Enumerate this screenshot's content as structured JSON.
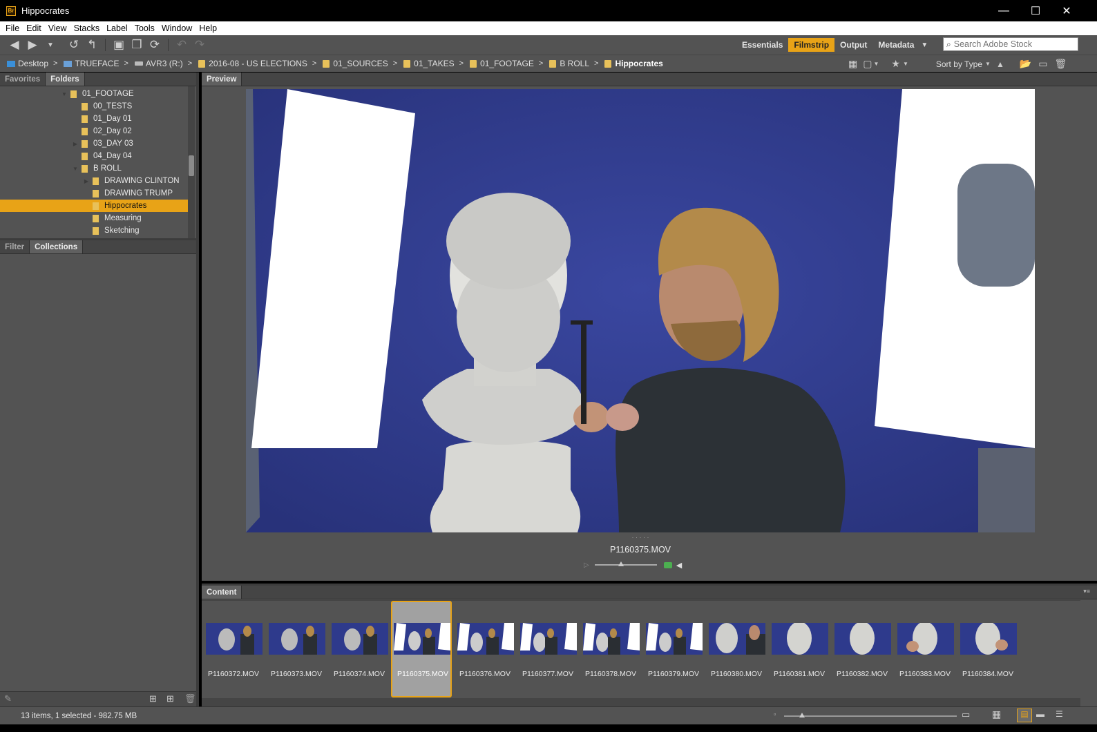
{
  "window": {
    "title": "Hippocrates",
    "app_icon_text": "Br",
    "minimize": "—",
    "maximize": "☐",
    "close": "✕"
  },
  "menu": [
    "File",
    "Edit",
    "View",
    "Stacks",
    "Label",
    "Tools",
    "Window",
    "Help"
  ],
  "workspaces": {
    "items": [
      "Essentials",
      "Filmstrip",
      "Output",
      "Metadata"
    ],
    "active": "Filmstrip"
  },
  "search": {
    "placeholder": "Search Adobe Stock"
  },
  "path": [
    "Desktop",
    "TRUEFACE",
    "AVR3 (R:)",
    "2016-08 - US ELECTIONS",
    "01_SOURCES",
    "01_TAKES",
    "01_FOOTAGE",
    "B ROLL",
    "Hippocrates"
  ],
  "sort": {
    "label": "Sort by Type"
  },
  "left_tabs_top": [
    "Favorites",
    "Folders"
  ],
  "left_tabs_bottom": [
    "Filter",
    "Collections"
  ],
  "folders": [
    {
      "label": "01_FOOTAGE",
      "level": 0,
      "expanded": true
    },
    {
      "label": "00_TESTS",
      "level": 1
    },
    {
      "label": "01_Day 01",
      "level": 1
    },
    {
      "label": "02_Day 02",
      "level": 1
    },
    {
      "label": "03_DAY 03",
      "level": 1,
      "collapsed": true
    },
    {
      "label": "04_Day 04",
      "level": 1
    },
    {
      "label": "B ROLL",
      "level": 1,
      "expanded": true
    },
    {
      "label": "DRAWING CLINTON",
      "level": 2,
      "collapsed": true
    },
    {
      "label": "DRAWING TRUMP",
      "level": 2
    },
    {
      "label": "Hippocrates",
      "level": 2,
      "selected": true
    },
    {
      "label": "Measuring",
      "level": 2
    },
    {
      "label": "Sketching",
      "level": 2
    }
  ],
  "preview": {
    "tab": "Preview",
    "filename": "P1160375.MOV",
    "dots": "· · · · ·"
  },
  "content": {
    "tab": "Content",
    "selected_index": 3,
    "files": [
      "P1160372.MOV",
      "P1160373.MOV",
      "P1160374.MOV",
      "P1160375.MOV",
      "P1160376.MOV",
      "P1160377.MOV",
      "P1160378.MOV",
      "P1160379.MOV",
      "P1160380.MOV",
      "P1160381.MOV",
      "P1160382.MOV",
      "P1160383.MOV",
      "P1160384.MOV"
    ]
  },
  "status": {
    "text": "13 items, 1 selected - 982.75 MB"
  },
  "colors": {
    "accent": "#e8a317",
    "panel": "#535353",
    "backdrop_blue": "#2e3a8c",
    "folder_yellow": "#e8c15a"
  }
}
